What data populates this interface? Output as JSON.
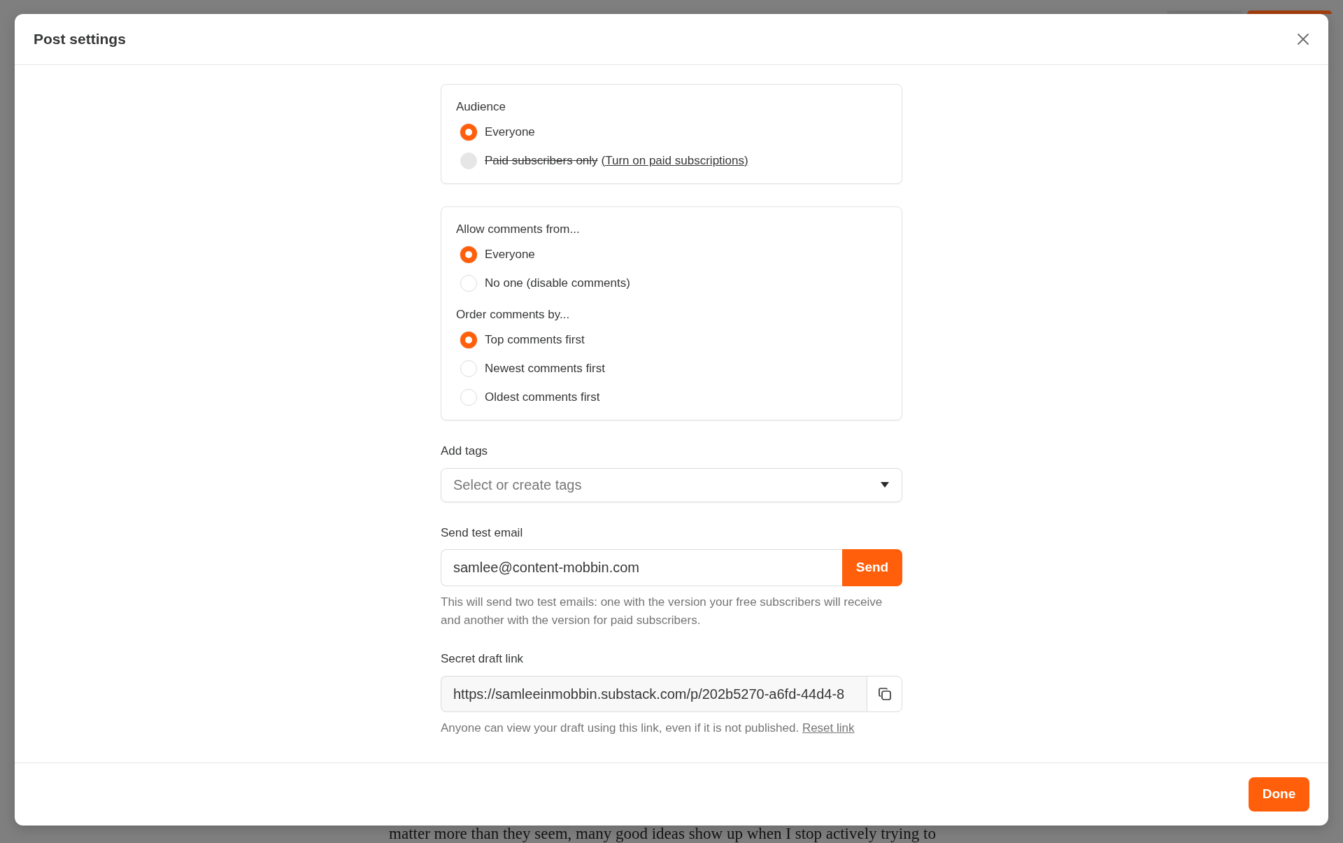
{
  "dialog": {
    "title": "Post settings",
    "audience": {
      "heading": "Audience",
      "options": [
        {
          "label": "Everyone",
          "selected": true,
          "disabled": false
        },
        {
          "label": "Paid subscribers only",
          "link": "(Turn on paid subscriptions)",
          "selected": false,
          "disabled": true
        }
      ]
    },
    "comments": {
      "groups": [
        {
          "heading": "Allow comments from...",
          "options": [
            {
              "label": "Everyone",
              "selected": true
            },
            {
              "label": "No one (disable comments)",
              "selected": false
            }
          ]
        },
        {
          "heading": "Order comments by...",
          "options": [
            {
              "label": "Top comments first",
              "selected": true
            },
            {
              "label": "Newest comments first",
              "selected": false
            },
            {
              "label": "Oldest comments first",
              "selected": false
            }
          ]
        }
      ]
    },
    "tags": {
      "label": "Add tags",
      "placeholder": "Select or create tags"
    },
    "test_email": {
      "label": "Send test email",
      "value": "samlee@content-mobbin.com",
      "button": "Send",
      "help": "This will send two test emails: one with the version your free subscribers will receive and another with the version for paid subscribers."
    },
    "draft_link": {
      "label": "Secret draft link",
      "value": "https://samleeinmobbin.substack.com/p/202b5270-a6fd-44d4-8",
      "help": "Anyone can view your draft using this link, even if it is not published.",
      "link": "Reset link"
    },
    "footer": {
      "button": "Done"
    }
  },
  "background_page": {
    "text": "matter more than they seem, many good ideas show up when I stop actively trying to"
  }
}
